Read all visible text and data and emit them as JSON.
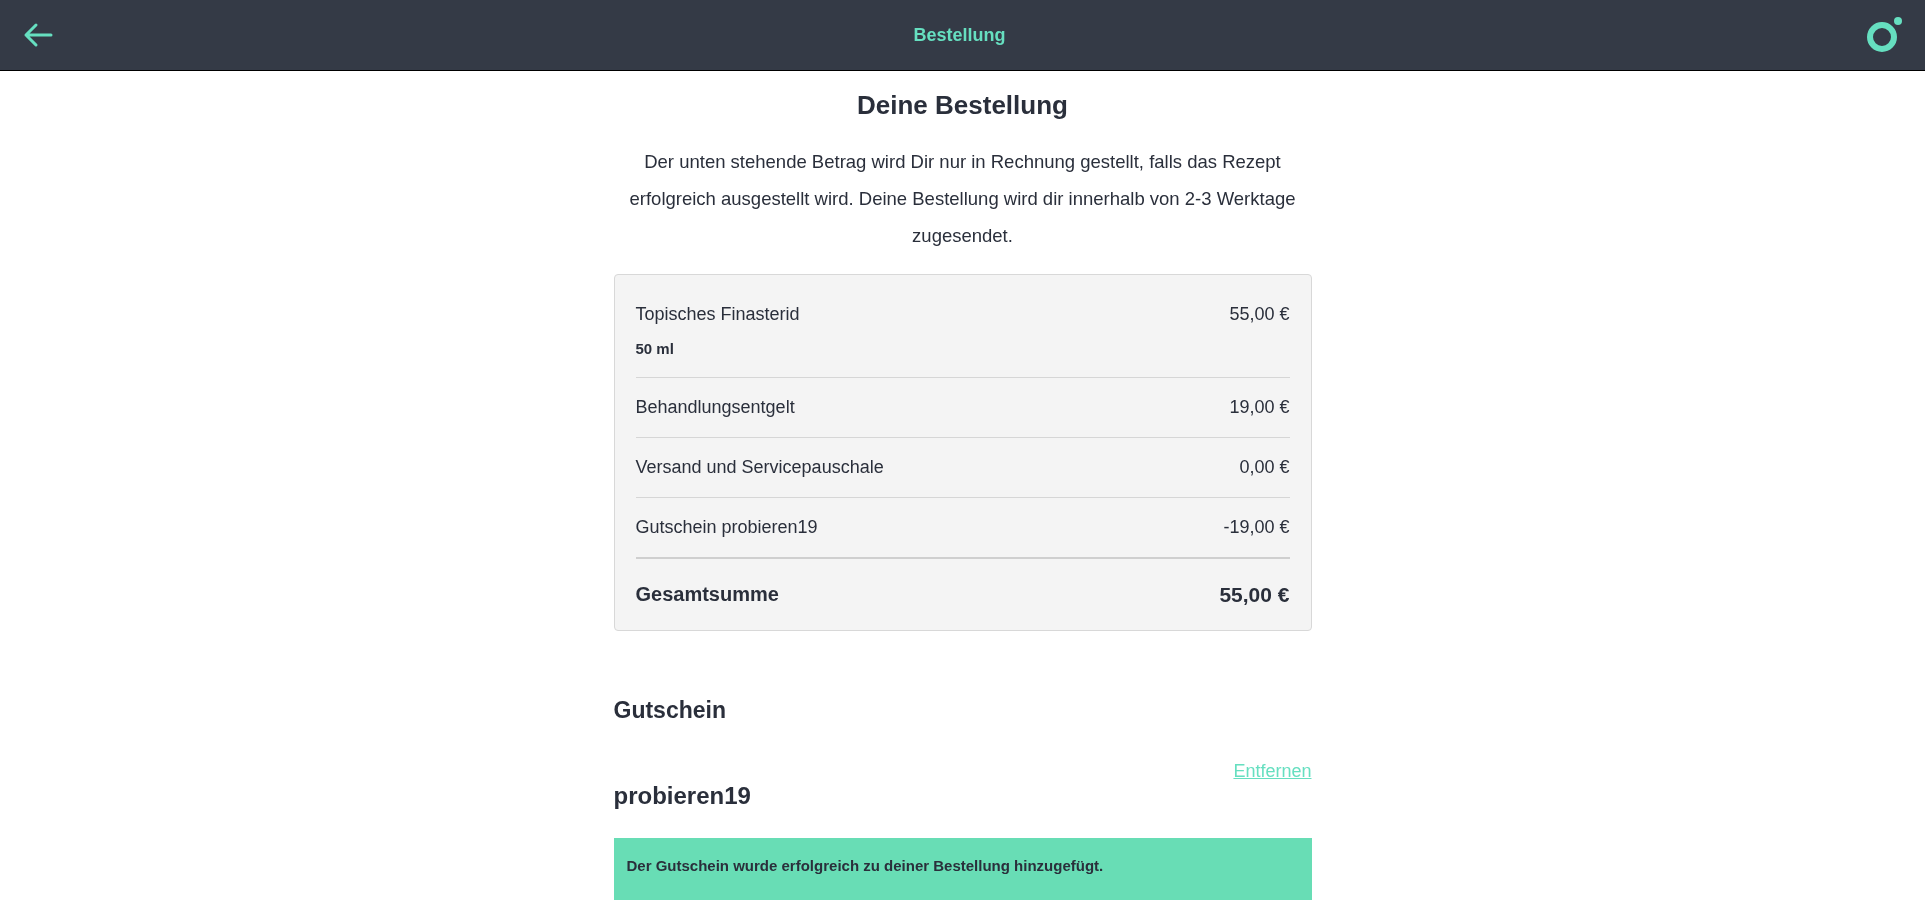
{
  "header": {
    "title": "Bestellung"
  },
  "heading": "Deine Bestellung",
  "intro": "Der unten stehende Betrag wird Dir nur in Rechnung gestellt, falls das Rezept erfolgreich ausgestellt wird. Deine Bestellung wird dir innerhalb von 2-3 Werktage zugesendet.",
  "summary": [
    {
      "kind": "item",
      "label": "Topisches Finasterid",
      "detail": "50 ml",
      "amount": "55,00 €"
    },
    {
      "kind": "item",
      "label": "Behandlungsentgelt",
      "amount": "19,00 €"
    },
    {
      "kind": "item",
      "label": "Versand und Servicepauschale",
      "amount": "0,00 €"
    },
    {
      "kind": "item",
      "label": "Gutschein probieren19",
      "amount": "-19,00 €"
    },
    {
      "kind": "total",
      "label": "Gesamtsumme",
      "amount": "55,00 €"
    }
  ],
  "voucher": {
    "heading": "Gutschein",
    "code": "probieren19",
    "remove_link": "Entfernen",
    "message": "Der Gutschein wurde erfolgreich zu deiner Bestellung hinzugefügt."
  }
}
